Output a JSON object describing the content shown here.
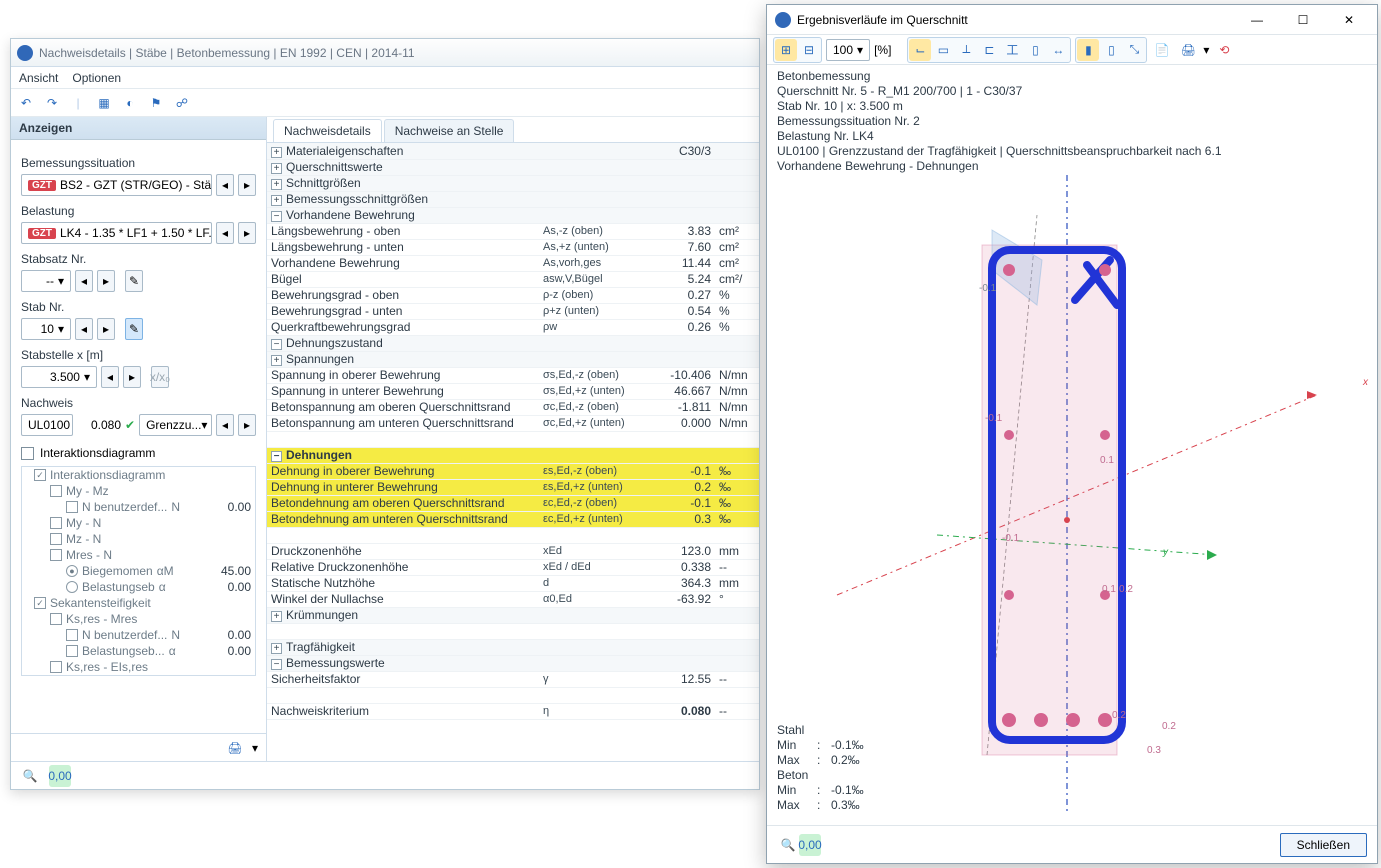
{
  "main": {
    "title": "Nachweisdetails | Stäbe | Betonbemessung | EN 1992 | CEN | 2014-11",
    "menu": {
      "ansicht": "Ansicht",
      "optionen": "Optionen"
    },
    "left": {
      "header": "Anzeigen",
      "bem_label": "Bemessungssituation",
      "bem_badge": "GZT",
      "bem_value": "BS2 - GZT (STR/GEO) - Stä...",
      "bel_label": "Belastung",
      "bel_badge": "GZT",
      "bel_value": "LK4 - 1.35 * LF1 + 1.50 * LF...",
      "stabsatz_label": "Stabsatz Nr.",
      "stabsatz_value": "--",
      "stab_label": "Stab Nr.",
      "stab_value": "10",
      "stabstelle_label": "Stabstelle x [m]",
      "stabstelle_value": "3.500",
      "nachweis_label": "Nachweis",
      "nachweis_code": "UL0100",
      "nachweis_val": "0.080",
      "nachweis_desc": "Grenzzu...",
      "chk_inter": "Interaktionsdiagramm",
      "tree": [
        {
          "ind": 0,
          "chk": true,
          "txt": "Interaktionsdiagramm"
        },
        {
          "ind": 1,
          "chk": false,
          "txt": "My - Mz"
        },
        {
          "ind": 2,
          "chk": false,
          "txt": "N benutzerdef...",
          "sym": "N",
          "val": "0.00"
        },
        {
          "ind": 1,
          "chk": false,
          "txt": "My - N"
        },
        {
          "ind": 1,
          "chk": false,
          "txt": "Mz - N"
        },
        {
          "ind": 1,
          "chk": false,
          "txt": "Mres - N"
        },
        {
          "ind": 2,
          "radio": true,
          "txt": "Biegemomen",
          "sym": "αM",
          "val": "45.00"
        },
        {
          "ind": 2,
          "radio": false,
          "txt": "Belastungseb",
          "sym": "α",
          "val": "0.00"
        },
        {
          "ind": 0,
          "chk": true,
          "txt": "Sekantensteifigkeit"
        },
        {
          "ind": 1,
          "chk": false,
          "txt": "Ks,res - Mres"
        },
        {
          "ind": 2,
          "chk": false,
          "txt": "N benutzerdef...",
          "sym": "N",
          "val": "0.00"
        },
        {
          "ind": 2,
          "chk": false,
          "txt": "Belastungseb...",
          "sym": "α",
          "val": "0.00"
        },
        {
          "ind": 1,
          "chk": false,
          "txt": "Ks,res - EIs,res"
        }
      ]
    },
    "tabs": {
      "t1": "Nachweisdetails",
      "t2": "Nachweise an Stelle"
    },
    "grid": {
      "mat_head": "Materialeigenschaften",
      "mat_val": "C30/3",
      "qs_head": "Querschnittswerte",
      "sg_head": "Schnittgrößen",
      "bsg_head": "Bemessungsschnittgrößen",
      "vb_head": "Vorhandene Bewehrung",
      "rows_vb": [
        {
          "n": "Längsbewehrung - oben",
          "s": "As,-z (oben)",
          "v": "3.83",
          "u": "cm²"
        },
        {
          "n": "Längsbewehrung - unten",
          "s": "As,+z (unten)",
          "v": "7.60",
          "u": "cm²"
        },
        {
          "n": "Vorhandene Bewehrung",
          "s": "As,vorh,ges",
          "v": "11.44",
          "u": "cm²"
        },
        {
          "n": "Bügel",
          "s": "asw,V,Bügel",
          "v": "5.24",
          "u": "cm²/"
        },
        {
          "n": "Bewehrungsgrad - oben",
          "s": "ρ-z (oben)",
          "v": "0.27",
          "u": "%"
        },
        {
          "n": "Bewehrungsgrad - unten",
          "s": "ρ+z (unten)",
          "v": "0.54",
          "u": "%"
        },
        {
          "n": "Querkraftbewehrungsgrad",
          "s": "ρw",
          "v": "0.26",
          "u": "%"
        }
      ],
      "dz_head": "Dehnungszustand",
      "sp_head": "Spannungen",
      "rows_sp": [
        {
          "n": "Spannung in oberer Bewehrung",
          "s": "σs,Ed,-z (oben)",
          "v": "-10.406",
          "u": "N/mn"
        },
        {
          "n": "Spannung in unterer Bewehrung",
          "s": "σs,Ed,+z (unten)",
          "v": "46.667",
          "u": "N/mn"
        },
        {
          "n": "Betonspannung am oberen Querschnittsrand",
          "s": "σc,Ed,-z (oben)",
          "v": "-1.811",
          "u": "N/mn"
        },
        {
          "n": "Betonspannung am unteren Querschnittsrand",
          "s": "σc,Ed,+z (unten)",
          "v": "0.000",
          "u": "N/mn"
        }
      ],
      "de_head": "Dehnungen",
      "rows_de": [
        {
          "n": "Dehnung in oberer Bewehrung",
          "s": "εs,Ed,-z (oben)",
          "v": "-0.1",
          "u": "‰"
        },
        {
          "n": "Dehnung in unterer Bewehrung",
          "s": "εs,Ed,+z (unten)",
          "v": "0.2",
          "u": "‰"
        },
        {
          "n": "Betondehnung am oberen Querschnittsrand",
          "s": "εc,Ed,-z (oben)",
          "v": "-0.1",
          "u": "‰"
        },
        {
          "n": "Betondehnung am unteren Querschnittsrand",
          "s": "εc,Ed,+z (unten)",
          "v": "0.3",
          "u": "‰"
        }
      ],
      "rows_geom": [
        {
          "n": "Druckzonenhöhe",
          "s": "xEd",
          "v": "123.0",
          "u": "mm"
        },
        {
          "n": "Relative Druckzonenhöhe",
          "s": "xEd / dEd",
          "v": "0.338",
          "u": "--"
        },
        {
          "n": "Statische Nutzhöhe",
          "s": "d",
          "v": "364.3",
          "u": "mm"
        },
        {
          "n": "Winkel der Nullachse",
          "s": "α0,Ed",
          "v": "-63.92",
          "u": "°"
        }
      ],
      "kr_head": "Krümmungen",
      "tf_head": "Tragfähigkeit",
      "bw_head": "Bemessungswerte",
      "sf": {
        "n": "Sicherheitsfaktor",
        "s": "γ",
        "v": "12.55",
        "u": "--"
      },
      "nk": {
        "n": "Nachweiskriterium",
        "s": "η",
        "v": "0.080",
        "u": "--"
      }
    }
  },
  "float": {
    "title": "Ergebnisverläufe im Querschnitt",
    "zoom": "100",
    "zoom_unit": "[%]",
    "info": [
      "Betonbemessung",
      "Querschnitt Nr. 5 - R_M1 200/700 | 1 - C30/37",
      "Stab Nr. 10 | x: 3.500 m",
      "Bemessungssituation Nr. 2",
      "Belastung Nr. LK4",
      "UL0100 | Grenzzustand der Tragfähigkeit | Querschnittsbeanspruchbarkeit nach 6.1",
      "Vorhandene Bewehrung - Dehnungen"
    ],
    "legend": {
      "stahl": "Stahl",
      "stahl_min": "-0.1‰",
      "stahl_max": "0.2‰",
      "beton": "Beton",
      "beton_min": "-0.1‰",
      "beton_max": "0.3‰",
      "min": "Min",
      "max": "Max"
    },
    "annot": {
      "m01a": "-0.1",
      "m01b": "-0.1",
      "m01c": "-0.1",
      "p01a": "0.1",
      "p01b": "0.1",
      "p02a": "0.2",
      "p02b": "0.2",
      "p02c": "0.2",
      "p03": "0.3",
      "y": "y",
      "x": "x"
    },
    "close": "Schließen"
  }
}
